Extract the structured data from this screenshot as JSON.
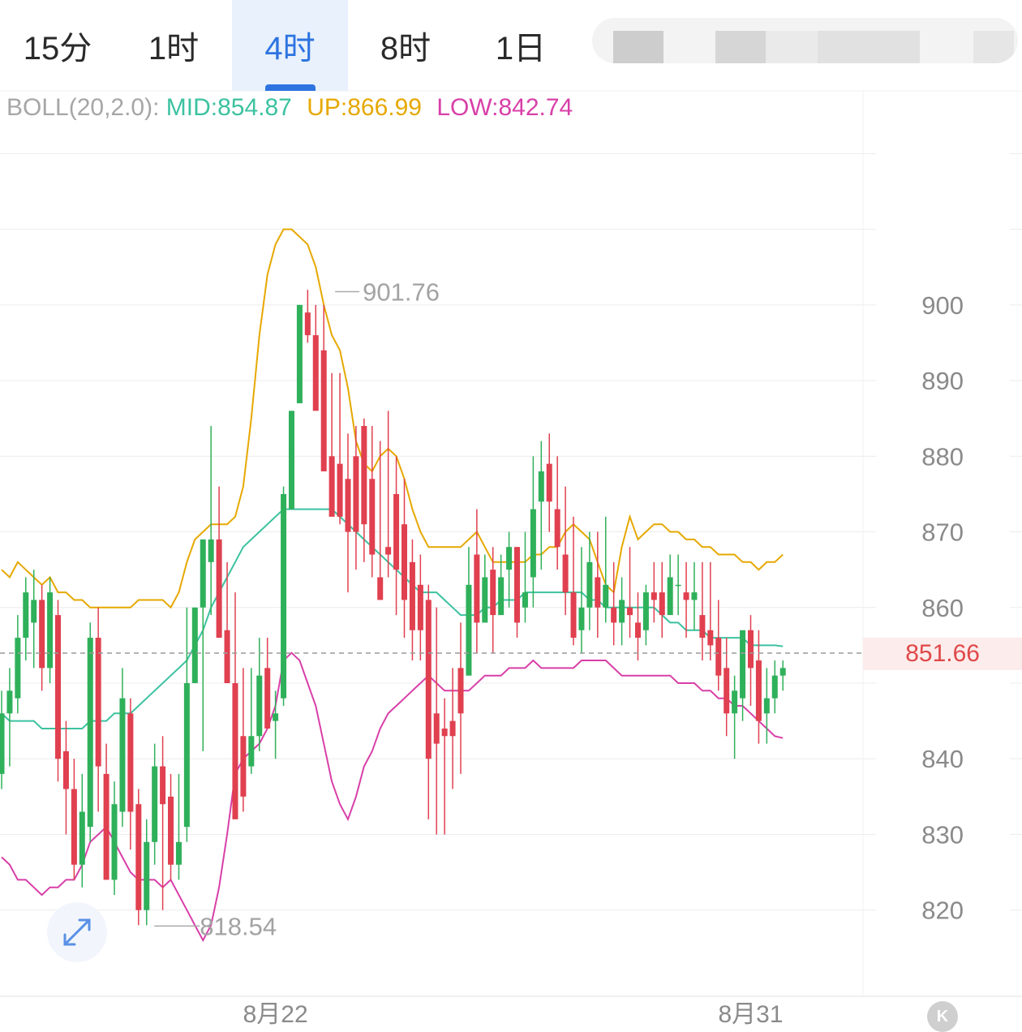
{
  "tabs": [
    {
      "label": "15分",
      "active": false
    },
    {
      "label": "1时",
      "active": false
    },
    {
      "label": "4时",
      "active": true
    },
    {
      "label": "8时",
      "active": false
    },
    {
      "label": "1日",
      "active": false
    }
  ],
  "indicator": {
    "name": "BOLL(20,2.0):",
    "mid": "MID:854.87",
    "up": "UP:866.99",
    "low": "LOW:842.74"
  },
  "colors": {
    "up_candle": "#2fb05a",
    "down_candle": "#e0404f",
    "mid_line": "#3cc2a0",
    "up_line": "#e6a800",
    "low_line": "#d83fa8",
    "accent": "#2d74e0"
  },
  "current_price_label": "851.66",
  "chart_data": {
    "type": "candlestick",
    "y_ticks": [
      "900",
      "890",
      "880",
      "870",
      "860",
      "840",
      "830",
      "820"
    ],
    "y_tick_values": [
      900,
      890,
      880,
      870,
      860,
      840,
      830,
      820
    ],
    "ylim": [
      808.6,
      928.3
    ],
    "x_labels": [
      {
        "label": "8月22",
        "index": 34
      },
      {
        "label": "8月31",
        "index": 93
      }
    ],
    "max_annotation": {
      "label": "901.76",
      "value": 901.76,
      "index": 41
    },
    "min_annotation": {
      "label": "818.54",
      "value": 818.54,
      "index": 25
    },
    "current_price": 851.66,
    "grid": true,
    "candles": [
      [
        838,
        846,
        836,
        849
      ],
      [
        846,
        849,
        839,
        852
      ],
      [
        848,
        856,
        846,
        859
      ],
      [
        856,
        862,
        853,
        864
      ],
      [
        858,
        861,
        852,
        865
      ],
      [
        861,
        852,
        849,
        863
      ],
      [
        852,
        862,
        850,
        864
      ],
      [
        859,
        840,
        837,
        861
      ],
      [
        841,
        836,
        830,
        845
      ],
      [
        836,
        826,
        824,
        840
      ],
      [
        826,
        833,
        823,
        838
      ],
      [
        831,
        856,
        829,
        858
      ],
      [
        856,
        839,
        833,
        860
      ],
      [
        838,
        824,
        825,
        842
      ],
      [
        824,
        834,
        822,
        837
      ],
      [
        833,
        848,
        831,
        852
      ],
      [
        846,
        833,
        828,
        848
      ],
      [
        834,
        820,
        818,
        836
      ],
      [
        820,
        829,
        818,
        832
      ],
      [
        829,
        839,
        826,
        842
      ],
      [
        839,
        834,
        820,
        843
      ],
      [
        835,
        826,
        824,
        838
      ],
      [
        826,
        829,
        824,
        838
      ],
      [
        831,
        850,
        829,
        860
      ],
      [
        850,
        860,
        851,
        860
      ],
      [
        860,
        869,
        841,
        866
      ],
      [
        866,
        869,
        859,
        884
      ],
      [
        869,
        856,
        856,
        876
      ],
      [
        857,
        850,
        854,
        866
      ],
      [
        850,
        832,
        834,
        862
      ],
      [
        843,
        835,
        833,
        852
      ],
      [
        839,
        843,
        838,
        852
      ],
      [
        843,
        851,
        841,
        856
      ],
      [
        852,
        844,
        844,
        856
      ],
      [
        845,
        846,
        840,
        849
      ],
      [
        848,
        875,
        847,
        876
      ],
      [
        873,
        886,
        880,
        886
      ],
      [
        887,
        900,
        893,
        900
      ],
      [
        899,
        896,
        895,
        902
      ],
      [
        896,
        886,
        887,
        900
      ],
      [
        894,
        878,
        878,
        900
      ],
      [
        880,
        872,
        875,
        891
      ],
      [
        879,
        872,
        871,
        891
      ],
      [
        877,
        870,
        862,
        883
      ],
      [
        880,
        870,
        865,
        884
      ],
      [
        884,
        871,
        866,
        885
      ],
      [
        877,
        867,
        864,
        884
      ],
      [
        864,
        861,
        861,
        882
      ],
      [
        868,
        867,
        864,
        886
      ],
      [
        875,
        865,
        859,
        880
      ],
      [
        871,
        861,
        856,
        877
      ],
      [
        866,
        857,
        853,
        869
      ],
      [
        863,
        857,
        853,
        867
      ],
      [
        861,
        840,
        832,
        863
      ],
      [
        846,
        842,
        830,
        860
      ],
      [
        844,
        843,
        830,
        848
      ],
      [
        845,
        843,
        836,
        852
      ],
      [
        852,
        846,
        838,
        858
      ],
      [
        851,
        863,
        860,
        868
      ],
      [
        867,
        858,
        854,
        873
      ],
      [
        858,
        864,
        858,
        867
      ],
      [
        865,
        859,
        854,
        868
      ],
      [
        859,
        864,
        860,
        867
      ],
      [
        865,
        868,
        860,
        870
      ],
      [
        868,
        858,
        856,
        868
      ],
      [
        860,
        862,
        858,
        870
      ],
      [
        864,
        873,
        860,
        880
      ],
      [
        874,
        878,
        865,
        882
      ],
      [
        879,
        874,
        870,
        883
      ],
      [
        873,
        868,
        865,
        880
      ],
      [
        867,
        862,
        859,
        876
      ],
      [
        862,
        856,
        855,
        872
      ],
      [
        857,
        860,
        854,
        868
      ],
      [
        860,
        866,
        857,
        870
      ],
      [
        864,
        860,
        856,
        870
      ],
      [
        860,
        863,
        858,
        872
      ],
      [
        860,
        858,
        855,
        866
      ],
      [
        858,
        861,
        855,
        864
      ],
      [
        860,
        859,
        856,
        868
      ],
      [
        858,
        856,
        853,
        862
      ],
      [
        857,
        862,
        855,
        863
      ],
      [
        862,
        861,
        858,
        866
      ],
      [
        862,
        859,
        856,
        866
      ],
      [
        859,
        864,
        860,
        867
      ],
      [
        863,
        863,
        859,
        867
      ],
      [
        862,
        861,
        856,
        866
      ],
      [
        861,
        862,
        857,
        866
      ],
      [
        859,
        856,
        853,
        866
      ],
      [
        857,
        855,
        853,
        866
      ],
      [
        856,
        851,
        849,
        861
      ],
      [
        852,
        846,
        843,
        856
      ],
      [
        846,
        849,
        840,
        851
      ],
      [
        848,
        857,
        845,
        856
      ],
      [
        857,
        852,
        847,
        859
      ],
      [
        853,
        845,
        842,
        857
      ],
      [
        846,
        848,
        842,
        852
      ],
      [
        848,
        851,
        846,
        853
      ],
      [
        851,
        852,
        849,
        853
      ]
    ],
    "series": [
      {
        "name": "UP",
        "values": [
          865,
          864,
          866,
          865,
          864,
          863,
          864,
          862,
          862,
          861,
          861,
          860,
          860,
          860,
          860,
          860,
          860,
          861,
          861,
          861,
          861,
          860,
          862,
          866,
          869,
          870,
          871,
          871,
          871,
          872,
          876,
          885,
          896,
          904,
          908,
          910,
          910,
          909,
          908,
          905,
          900,
          896,
          894,
          889,
          882,
          879,
          878,
          880,
          881,
          880,
          877,
          873,
          870,
          868,
          868,
          868,
          868,
          868,
          869,
          870,
          868,
          866,
          866,
          866,
          866,
          866,
          867,
          867,
          868,
          868,
          870,
          871,
          870,
          869,
          866,
          863,
          862,
          868,
          872,
          869,
          870,
          871,
          871,
          870,
          870,
          869,
          869,
          868,
          868,
          867,
          867,
          867,
          866,
          866,
          865,
          866,
          866,
          867
        ]
      },
      {
        "name": "MID",
        "values": [
          846,
          845,
          845,
          845,
          845,
          844,
          844,
          844,
          844,
          844,
          844,
          845,
          845,
          845,
          846,
          846,
          846,
          847,
          848,
          849,
          850,
          851,
          852,
          853,
          855,
          857,
          860,
          862,
          864,
          866,
          868,
          869,
          870,
          871,
          872,
          873,
          873,
          873,
          873,
          873,
          873,
          873,
          872,
          871,
          870,
          869,
          868,
          867,
          866,
          865,
          864,
          863,
          862,
          862,
          862,
          861,
          860,
          859,
          859,
          859,
          860,
          860,
          861,
          861,
          861,
          862,
          862,
          862,
          862,
          862,
          862,
          862,
          862,
          861,
          861,
          860,
          860,
          860,
          860,
          860,
          860,
          860,
          859,
          858,
          858,
          857,
          857,
          857,
          856,
          856,
          856,
          856,
          856,
          855,
          855,
          855,
          855,
          854.87
        ]
      },
      {
        "name": "LOW",
        "values": [
          827,
          826,
          824,
          824,
          823,
          822,
          823,
          823,
          824,
          824,
          826,
          829,
          830,
          831,
          829,
          827,
          825,
          824,
          824,
          824,
          823,
          824,
          822,
          820,
          818,
          816,
          818,
          823,
          830,
          838,
          840,
          841,
          842,
          844,
          847,
          853,
          854,
          853,
          850,
          847,
          842,
          837,
          834,
          832,
          835,
          839,
          841,
          844,
          846,
          847,
          848,
          849,
          850,
          851,
          850,
          849,
          849,
          849,
          849,
          850,
          851,
          851,
          851,
          852,
          852,
          852,
          853,
          852,
          852,
          852,
          852,
          852,
          853,
          853,
          853,
          853,
          852,
          851,
          851,
          851,
          851,
          851,
          851,
          851,
          850,
          850,
          850,
          849,
          849,
          848,
          848,
          847,
          847,
          846,
          845,
          844,
          843,
          842.74
        ]
      }
    ]
  }
}
